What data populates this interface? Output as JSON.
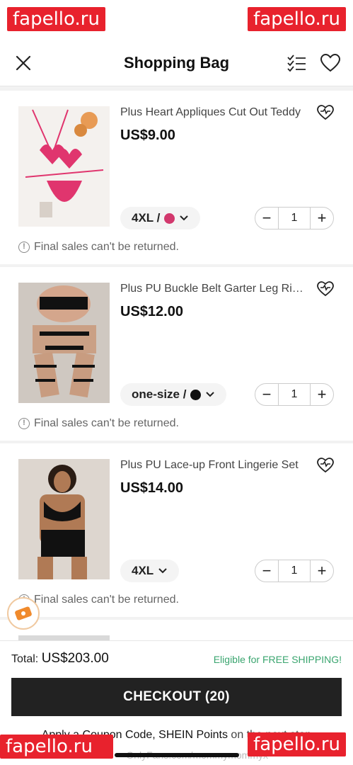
{
  "watermark": "fapello.ru",
  "header": {
    "title": "Shopping Bag"
  },
  "items": [
    {
      "name": "Plus Heart Appliques Cut Out Teddy",
      "price": "US$9.00",
      "attribute": "4XL /",
      "swatch_color": "#d2386d",
      "qty": "1",
      "notice": "Final sales can't be returned."
    },
    {
      "name": "Plus PU Buckle Belt Garter Leg Ring Set",
      "price": "US$12.00",
      "attribute": "one-size /",
      "swatch_color": "#111111",
      "qty": "1",
      "notice": "Final sales can't be returned."
    },
    {
      "name": "Plus PU Lace-up Front Lingerie Set",
      "price": "US$14.00",
      "attribute": "4XL",
      "swatch_color": "",
      "qty": "1",
      "notice": "Final sales can't be returned."
    }
  ],
  "footer": {
    "total_label": "Total:",
    "total_value": "US$203.00",
    "shipping_note": "Eligible for FREE SHIPPING!",
    "checkout_label": "CHECKOUT (20)",
    "coupon_prefix": "Apply a Coupon Code, SHEIN Points",
    "coupon_suffix": "on the next step",
    "of_watermark": "OnlyFans.com/mommymommyx"
  },
  "colors": {
    "accent": "#222222",
    "shipping": "#3aa56f",
    "watermark": "#e8222d"
  }
}
